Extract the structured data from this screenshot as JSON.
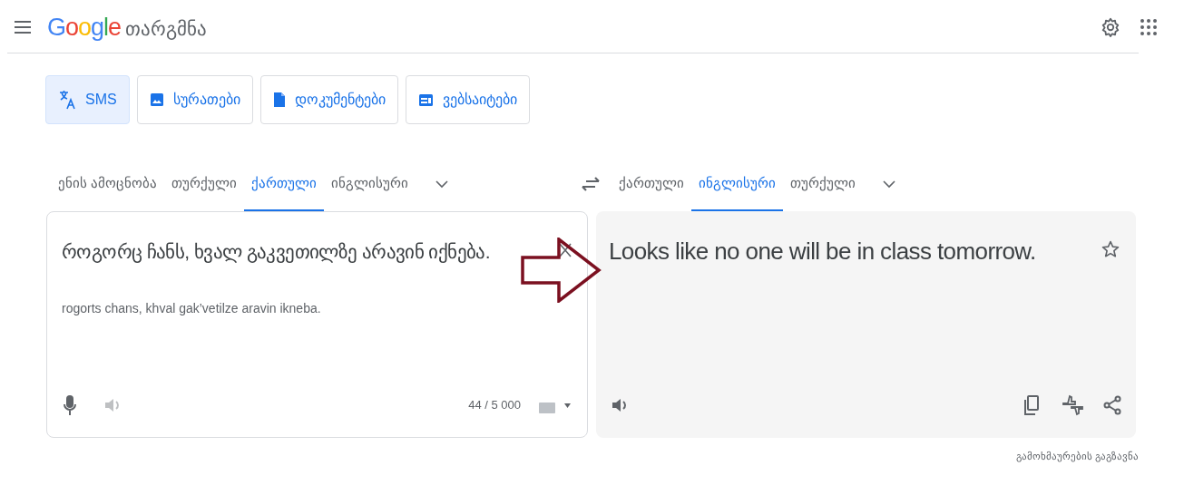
{
  "header": {
    "logo": "Google",
    "product": "თარგმნა"
  },
  "modes": [
    {
      "label": "SMS",
      "kind": "translate",
      "selected": true
    },
    {
      "label": "სურათები",
      "kind": "image",
      "selected": false
    },
    {
      "label": "დოკუმენტები",
      "kind": "document",
      "selected": false
    },
    {
      "label": "ვებსაიტები",
      "kind": "website",
      "selected": false
    }
  ],
  "source_languages": [
    {
      "label": "ენის ამოცნობა",
      "selected": false
    },
    {
      "label": "თურქული",
      "selected": false
    },
    {
      "label": "ქართული",
      "selected": true
    },
    {
      "label": "ინგლისური",
      "selected": false
    }
  ],
  "target_languages": [
    {
      "label": "ქართული",
      "selected": false
    },
    {
      "label": "ინგლისური",
      "selected": true
    },
    {
      "label": "თურქული",
      "selected": false
    }
  ],
  "source": {
    "text": "როგორც ჩანს, ხვალ გაკვეთილზე არავინ იქნება.",
    "transliteration": "rogorts chans, khval gak’vetilze aravin ikneba.",
    "char_count": "44 / 5 000"
  },
  "target": {
    "text": "Looks like no one will be in class tomorrow."
  },
  "feedback_link": "გამოხმაურების გაგზავნა"
}
